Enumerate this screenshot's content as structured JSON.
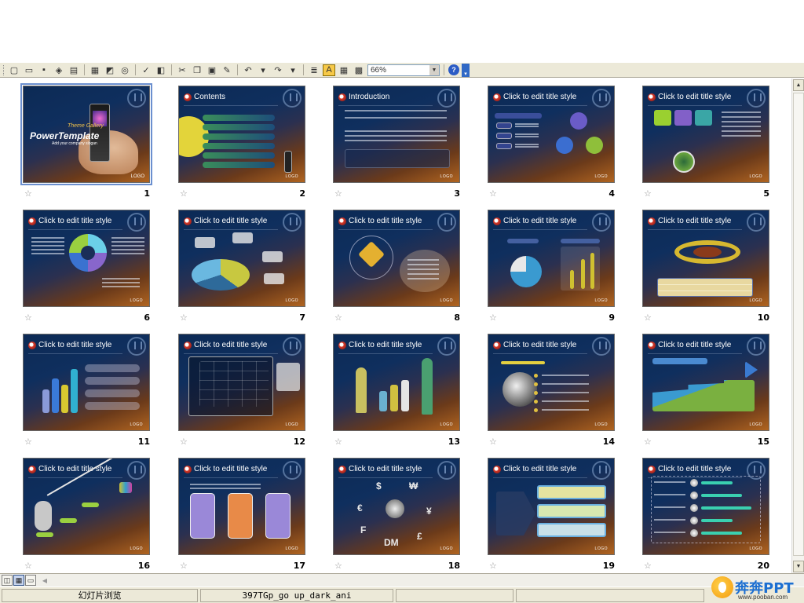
{
  "toolbar": {
    "zoom": "66%",
    "help_glyph": "?",
    "icons": [
      "new-icon",
      "open-icon",
      "save-icon",
      "permission-icon",
      "print-icon",
      "print-preview-icon",
      "research-icon",
      "spelling-icon",
      "cut-icon",
      "copy-icon",
      "paste-icon",
      "format-painter-icon",
      "undo-icon",
      "redo-icon",
      "expand-icon",
      "grayscale-icon",
      "grid-icon",
      "color-icon"
    ]
  },
  "slides": [
    {
      "num": "1",
      "title": "",
      "kind": "title",
      "sub": "Theme Gallery",
      "main": "PowerTemplate",
      "tag": "Add your company slogan",
      "logo": "LOGO"
    },
    {
      "num": "2",
      "title": "Contents",
      "kind": "contents"
    },
    {
      "num": "3",
      "title": "Introduction",
      "kind": "intro"
    },
    {
      "num": "4",
      "title": "Click to edit title style",
      "kind": "cycle"
    },
    {
      "num": "5",
      "title": "Click to edit title style",
      "kind": "boxes"
    },
    {
      "num": "6",
      "title": "Click to edit title style",
      "kind": "donut"
    },
    {
      "num": "7",
      "title": "Click to edit title style",
      "kind": "pie3d"
    },
    {
      "num": "8",
      "title": "Click to edit title style",
      "kind": "radar"
    },
    {
      "num": "9",
      "title": "Click to edit title style",
      "kind": "piebar"
    },
    {
      "num": "10",
      "title": "Click to edit title style",
      "kind": "ring"
    },
    {
      "num": "11",
      "title": "Click to edit title style",
      "kind": "bars3d"
    },
    {
      "num": "12",
      "title": "Click to edit title style",
      "kind": "linechart"
    },
    {
      "num": "13",
      "title": "Click to edit title style",
      "kind": "people"
    },
    {
      "num": "14",
      "title": "Click to edit title style",
      "kind": "globe"
    },
    {
      "num": "15",
      "title": "Click to edit title style",
      "kind": "arrow"
    },
    {
      "num": "16",
      "title": "Click to edit title style",
      "kind": "stairs"
    },
    {
      "num": "17",
      "title": "Click to edit title style",
      "kind": "three"
    },
    {
      "num": "18",
      "title": "Click to edit title style",
      "kind": "currency"
    },
    {
      "num": "19",
      "title": "Click to edit title style",
      "kind": "arrowlist"
    },
    {
      "num": "20",
      "title": "Click to edit title style",
      "kind": "hbars"
    }
  ],
  "status": {
    "view": "幻灯片浏览",
    "design": "397TGp_go up_dark_ani"
  },
  "watermark": {
    "brand": "奔奔PPT",
    "url": "www.pooban.com"
  },
  "colors": {
    "slide_dark": "#0f2f5e",
    "slide_warm": "#b06420",
    "selection": "#6b8fcf"
  }
}
